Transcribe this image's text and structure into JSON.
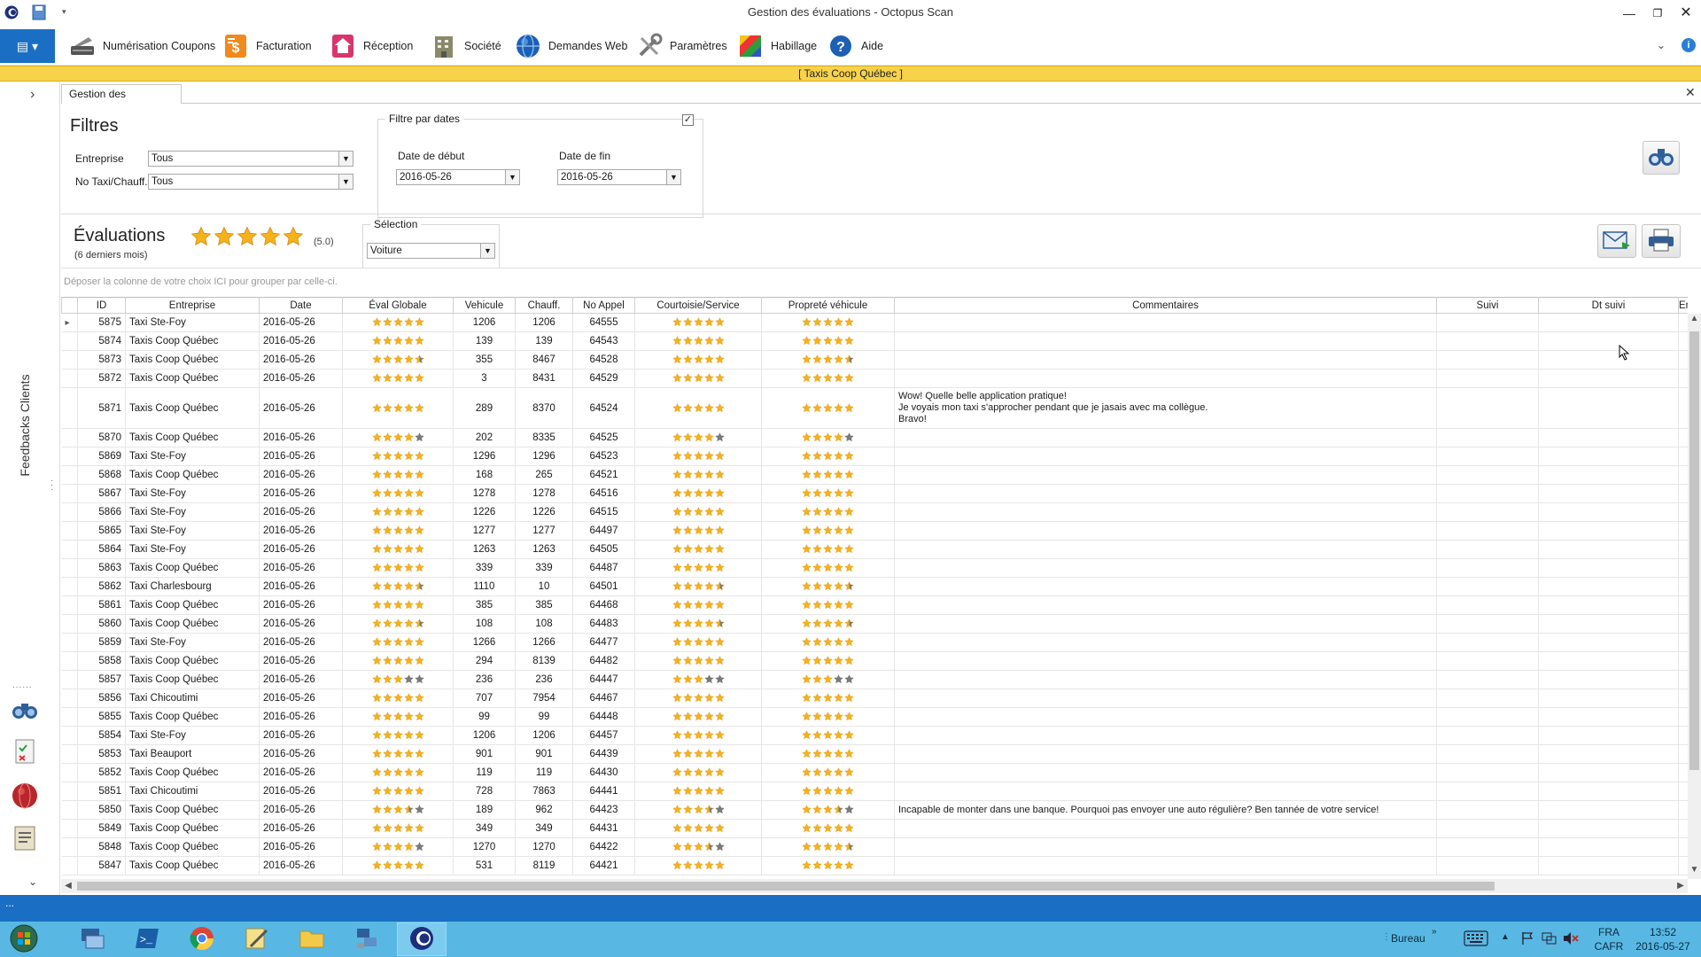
{
  "window": {
    "title": "Gestion des évaluations - Octopus Scan"
  },
  "menu": {
    "items": [
      {
        "label": "Numérisation Coupons",
        "icon": "scanner-icon"
      },
      {
        "label": "Facturation",
        "icon": "billing-icon"
      },
      {
        "label": "Réception",
        "icon": "reception-icon"
      },
      {
        "label": "Société",
        "icon": "company-icon"
      },
      {
        "label": "Demandes Web",
        "icon": "globe-icon"
      },
      {
        "label": "Paramètres",
        "icon": "tools-icon"
      },
      {
        "label": "Habillage",
        "icon": "palette-icon"
      },
      {
        "label": "Aide",
        "icon": "help-icon"
      }
    ]
  },
  "banner": {
    "text": "[   Taxis Coop Québec   ]"
  },
  "sidebar": {
    "label": "Feedbacks Clients",
    "dots": "......"
  },
  "tab": {
    "label": "Gestion des évaluations"
  },
  "filters": {
    "title": "Filtres",
    "entreprise_label": "Entreprise",
    "entreprise_value": "Tous",
    "taxi_label": "No Taxi/Chauff.",
    "taxi_value": "Tous",
    "date_filter_label": "Filtre par dates",
    "date_filter_checked": true,
    "date_start_label": "Date de début",
    "date_start_value": "2016-05-26",
    "date_end_label": "Date de fin",
    "date_end_value": "2016-05-26"
  },
  "evaluations": {
    "title": "Évaluations",
    "subtitle": "(6 derniers mois)",
    "rating": 5,
    "score_text": "(5.0)",
    "selection_label": "Sélection",
    "selection_value": "Voiture"
  },
  "group_hint": "Déposer la colonne de votre choix ICI pour grouper par celle-ci.",
  "columns": [
    "ID",
    "Entreprise",
    "Date",
    "Éval Globale",
    "Vehicule",
    "Chauff.",
    "No Appel",
    "Courtoisie/Service",
    "Propreté véhicule",
    "Commentaires",
    "Suivi",
    "Dt suivi",
    "Eml E"
  ],
  "rows": [
    {
      "id": "5875",
      "entreprise": "Taxi Ste-Foy",
      "date": "2016-05-26",
      "g": 5,
      "veh": "1206",
      "ch": "1206",
      "appel": "64555",
      "c": 5,
      "p": 5,
      "comment": ""
    },
    {
      "id": "5874",
      "entreprise": "Taxis Coop Québec",
      "date": "2016-05-26",
      "g": 5,
      "veh": "139",
      "ch": "139",
      "appel": "64543",
      "c": 5,
      "p": 5,
      "comment": ""
    },
    {
      "id": "5873",
      "entreprise": "Taxis Coop Québec",
      "date": "2016-05-26",
      "g": 4.5,
      "veh": "355",
      "ch": "8467",
      "appel": "64528",
      "c": 5,
      "p": 4.5,
      "comment": ""
    },
    {
      "id": "5872",
      "entreprise": "Taxis Coop Québec",
      "date": "2016-05-26",
      "g": 5,
      "veh": "3",
      "ch": "8431",
      "appel": "64529",
      "c": 5,
      "p": 5,
      "comment": ""
    },
    {
      "id": "5871",
      "entreprise": "Taxis Coop Québec",
      "date": "2016-05-26",
      "g": 5,
      "veh": "289",
      "ch": "8370",
      "appel": "64524",
      "c": 5,
      "p": 5,
      "comment": "Wow! Quelle belle application pratique!\nJe voyais mon taxi s'approcher pendant que je jasais avec ma collègue.\nBravo!"
    },
    {
      "id": "5870",
      "entreprise": "Taxis Coop Québec",
      "date": "2016-05-26",
      "g": 4,
      "veh": "202",
      "ch": "8335",
      "appel": "64525",
      "c": 4,
      "p": 4,
      "comment": ""
    },
    {
      "id": "5869",
      "entreprise": "Taxi Ste-Foy",
      "date": "2016-05-26",
      "g": 5,
      "veh": "1296",
      "ch": "1296",
      "appel": "64523",
      "c": 5,
      "p": 5,
      "comment": ""
    },
    {
      "id": "5868",
      "entreprise": "Taxis Coop Québec",
      "date": "2016-05-26",
      "g": 5,
      "veh": "168",
      "ch": "265",
      "appel": "64521",
      "c": 5,
      "p": 5,
      "comment": ""
    },
    {
      "id": "5867",
      "entreprise": "Taxi Ste-Foy",
      "date": "2016-05-26",
      "g": 5,
      "veh": "1278",
      "ch": "1278",
      "appel": "64516",
      "c": 5,
      "p": 5,
      "comment": ""
    },
    {
      "id": "5866",
      "entreprise": "Taxi Ste-Foy",
      "date": "2016-05-26",
      "g": 5,
      "veh": "1226",
      "ch": "1226",
      "appel": "64515",
      "c": 5,
      "p": 5,
      "comment": ""
    },
    {
      "id": "5865",
      "entreprise": "Taxi Ste-Foy",
      "date": "2016-05-26",
      "g": 5,
      "veh": "1277",
      "ch": "1277",
      "appel": "64497",
      "c": 5,
      "p": 5,
      "comment": ""
    },
    {
      "id": "5864",
      "entreprise": "Taxi Ste-Foy",
      "date": "2016-05-26",
      "g": 5,
      "veh": "1263",
      "ch": "1263",
      "appel": "64505",
      "c": 5,
      "p": 5,
      "comment": ""
    },
    {
      "id": "5863",
      "entreprise": "Taxis Coop Québec",
      "date": "2016-05-26",
      "g": 5,
      "veh": "339",
      "ch": "339",
      "appel": "64487",
      "c": 5,
      "p": 5,
      "comment": ""
    },
    {
      "id": "5862",
      "entreprise": "Taxi Charlesbourg",
      "date": "2016-05-26",
      "g": 4.5,
      "veh": "1110",
      "ch": "10",
      "appel": "64501",
      "c": 4.5,
      "p": 4.5,
      "comment": ""
    },
    {
      "id": "5861",
      "entreprise": "Taxis Coop Québec",
      "date": "2016-05-26",
      "g": 5,
      "veh": "385",
      "ch": "385",
      "appel": "64468",
      "c": 5,
      "p": 5,
      "comment": ""
    },
    {
      "id": "5860",
      "entreprise": "Taxis Coop Québec",
      "date": "2016-05-26",
      "g": 4.5,
      "veh": "108",
      "ch": "108",
      "appel": "64483",
      "c": 4.5,
      "p": 4.5,
      "comment": ""
    },
    {
      "id": "5859",
      "entreprise": "Taxi Ste-Foy",
      "date": "2016-05-26",
      "g": 5,
      "veh": "1266",
      "ch": "1266",
      "appel": "64477",
      "c": 5,
      "p": 5,
      "comment": ""
    },
    {
      "id": "5858",
      "entreprise": "Taxis Coop Québec",
      "date": "2016-05-26",
      "g": 5,
      "veh": "294",
      "ch": "8139",
      "appel": "64482",
      "c": 5,
      "p": 5,
      "comment": ""
    },
    {
      "id": "5857",
      "entreprise": "Taxis Coop Québec",
      "date": "2016-05-26",
      "g": 3,
      "veh": "236",
      "ch": "236",
      "appel": "64447",
      "c": 3,
      "p": 3,
      "comment": ""
    },
    {
      "id": "5856",
      "entreprise": "Taxi Chicoutimi",
      "date": "2016-05-26",
      "g": 5,
      "veh": "707",
      "ch": "7954",
      "appel": "64467",
      "c": 5,
      "p": 5,
      "comment": ""
    },
    {
      "id": "5855",
      "entreprise": "Taxis Coop Québec",
      "date": "2016-05-26",
      "g": 5,
      "veh": "99",
      "ch": "99",
      "appel": "64448",
      "c": 5,
      "p": 5,
      "comment": ""
    },
    {
      "id": "5854",
      "entreprise": "Taxi Ste-Foy",
      "date": "2016-05-26",
      "g": 5,
      "veh": "1206",
      "ch": "1206",
      "appel": "64457",
      "c": 5,
      "p": 5,
      "comment": ""
    },
    {
      "id": "5853",
      "entreprise": "Taxi Beauport",
      "date": "2016-05-26",
      "g": 5,
      "veh": "901",
      "ch": "901",
      "appel": "64439",
      "c": 5,
      "p": 5,
      "comment": ""
    },
    {
      "id": "5852",
      "entreprise": "Taxis Coop Québec",
      "date": "2016-05-26",
      "g": 5,
      "veh": "119",
      "ch": "119",
      "appel": "64430",
      "c": 5,
      "p": 5,
      "comment": ""
    },
    {
      "id": "5851",
      "entreprise": "Taxi Chicoutimi",
      "date": "2016-05-26",
      "g": 5,
      "veh": "728",
      "ch": "7863",
      "appel": "64441",
      "c": 5,
      "p": 5,
      "comment": ""
    },
    {
      "id": "5850",
      "entreprise": "Taxis Coop Québec",
      "date": "2016-05-26",
      "g": 3.5,
      "veh": "189",
      "ch": "962",
      "appel": "64423",
      "c": 3.5,
      "p": 3.5,
      "comment": "Incapable de monter dans une banque. Pourquoi pas envoyer une auto régulière? Ben tannée de votre service!"
    },
    {
      "id": "5849",
      "entreprise": "Taxis Coop Québec",
      "date": "2016-05-26",
      "g": 5,
      "veh": "349",
      "ch": "349",
      "appel": "64431",
      "c": 5,
      "p": 5,
      "comment": ""
    },
    {
      "id": "5848",
      "entreprise": "Taxis Coop Québec",
      "date": "2016-05-26",
      "g": 4,
      "veh": "1270",
      "ch": "1270",
      "appel": "64422",
      "c": 3.5,
      "p": 4.5,
      "comment": ""
    },
    {
      "id": "5847",
      "entreprise": "Taxis Coop Québec",
      "date": "2016-05-26",
      "g": 5,
      "veh": "531",
      "ch": "8119",
      "appel": "64421",
      "c": 5,
      "p": 5,
      "comment": ""
    }
  ],
  "statusbar": {
    "text": "..."
  },
  "taskbar": {
    "desktop_label": "Bureau",
    "lang_top": "FRA",
    "lang_bottom": "CAFR",
    "time": "13:52",
    "date": "2016-05-27"
  },
  "colors": {
    "accent": "#1a6fc4",
    "banner": "#f7d24b",
    "star": "#f6b21b",
    "star_empty": "#7a7a7a",
    "taskbar": "#58b8e3"
  }
}
